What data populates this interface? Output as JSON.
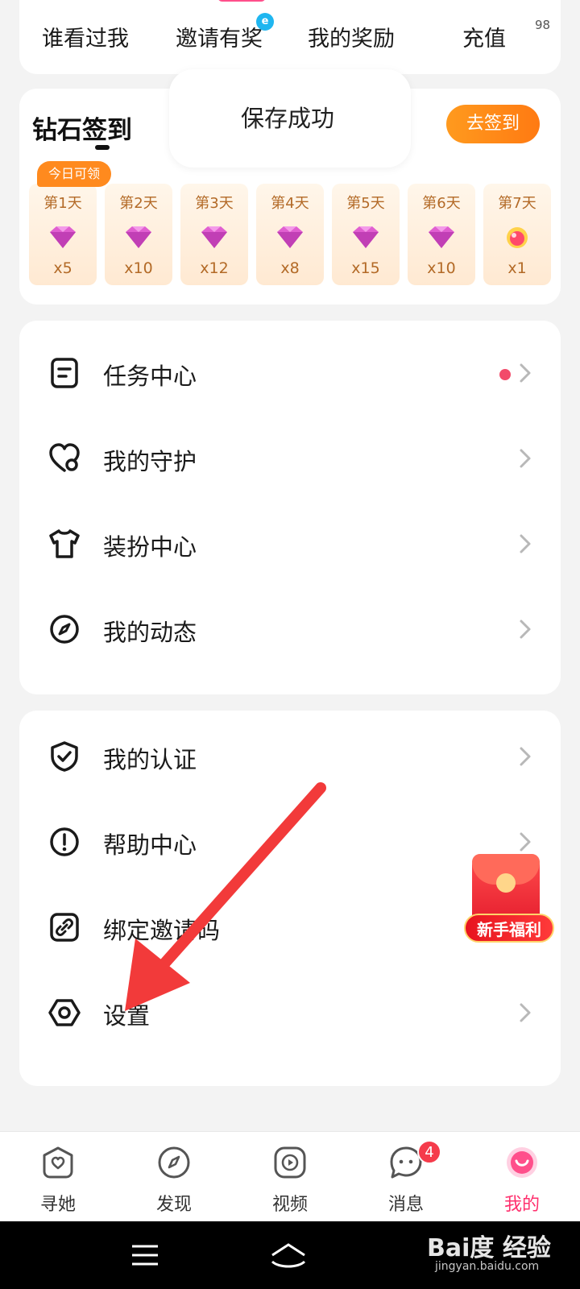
{
  "quick_links": {
    "items": [
      {
        "label": "谁看过我"
      },
      {
        "label": "邀请有奖"
      },
      {
        "label": "我的奖励"
      },
      {
        "label": "充值"
      }
    ],
    "recharge_count": "98"
  },
  "sign_in": {
    "title": "钻石签到",
    "button": "去签到",
    "today_tag": "今日可领",
    "days": [
      {
        "label": "第1天",
        "reward": "x5"
      },
      {
        "label": "第2天",
        "reward": "x10"
      },
      {
        "label": "第3天",
        "reward": "x12"
      },
      {
        "label": "第4天",
        "reward": "x8"
      },
      {
        "label": "第5天",
        "reward": "x15"
      },
      {
        "label": "第6天",
        "reward": "x10"
      },
      {
        "label": "第7天",
        "reward": "x1"
      }
    ]
  },
  "toast": {
    "text": "保存成功"
  },
  "menu1": {
    "items": [
      {
        "label": "任务中心",
        "icon": "task-icon"
      },
      {
        "label": "我的守护",
        "icon": "heart-icon"
      },
      {
        "label": "装扮中心",
        "icon": "shirt-icon"
      },
      {
        "label": "我的动态",
        "icon": "compass-icon"
      }
    ]
  },
  "menu2": {
    "items": [
      {
        "label": "我的认证",
        "icon": "shield-icon"
      },
      {
        "label": "帮助中心",
        "icon": "alert-icon"
      },
      {
        "label": "绑定邀请码",
        "icon": "link-icon"
      },
      {
        "label": "设置",
        "icon": "settings-icon"
      }
    ]
  },
  "gift": {
    "label": "新手福利"
  },
  "bottom_nav": {
    "items": [
      {
        "label": "寻她"
      },
      {
        "label": "发现"
      },
      {
        "label": "视频"
      },
      {
        "label": "消息",
        "badge": "4"
      },
      {
        "label": "我的"
      }
    ],
    "active_color": "#ff2f6d"
  },
  "watermark": {
    "text": "Bai度 经验",
    "sub": "jingyan.baidu.com"
  }
}
